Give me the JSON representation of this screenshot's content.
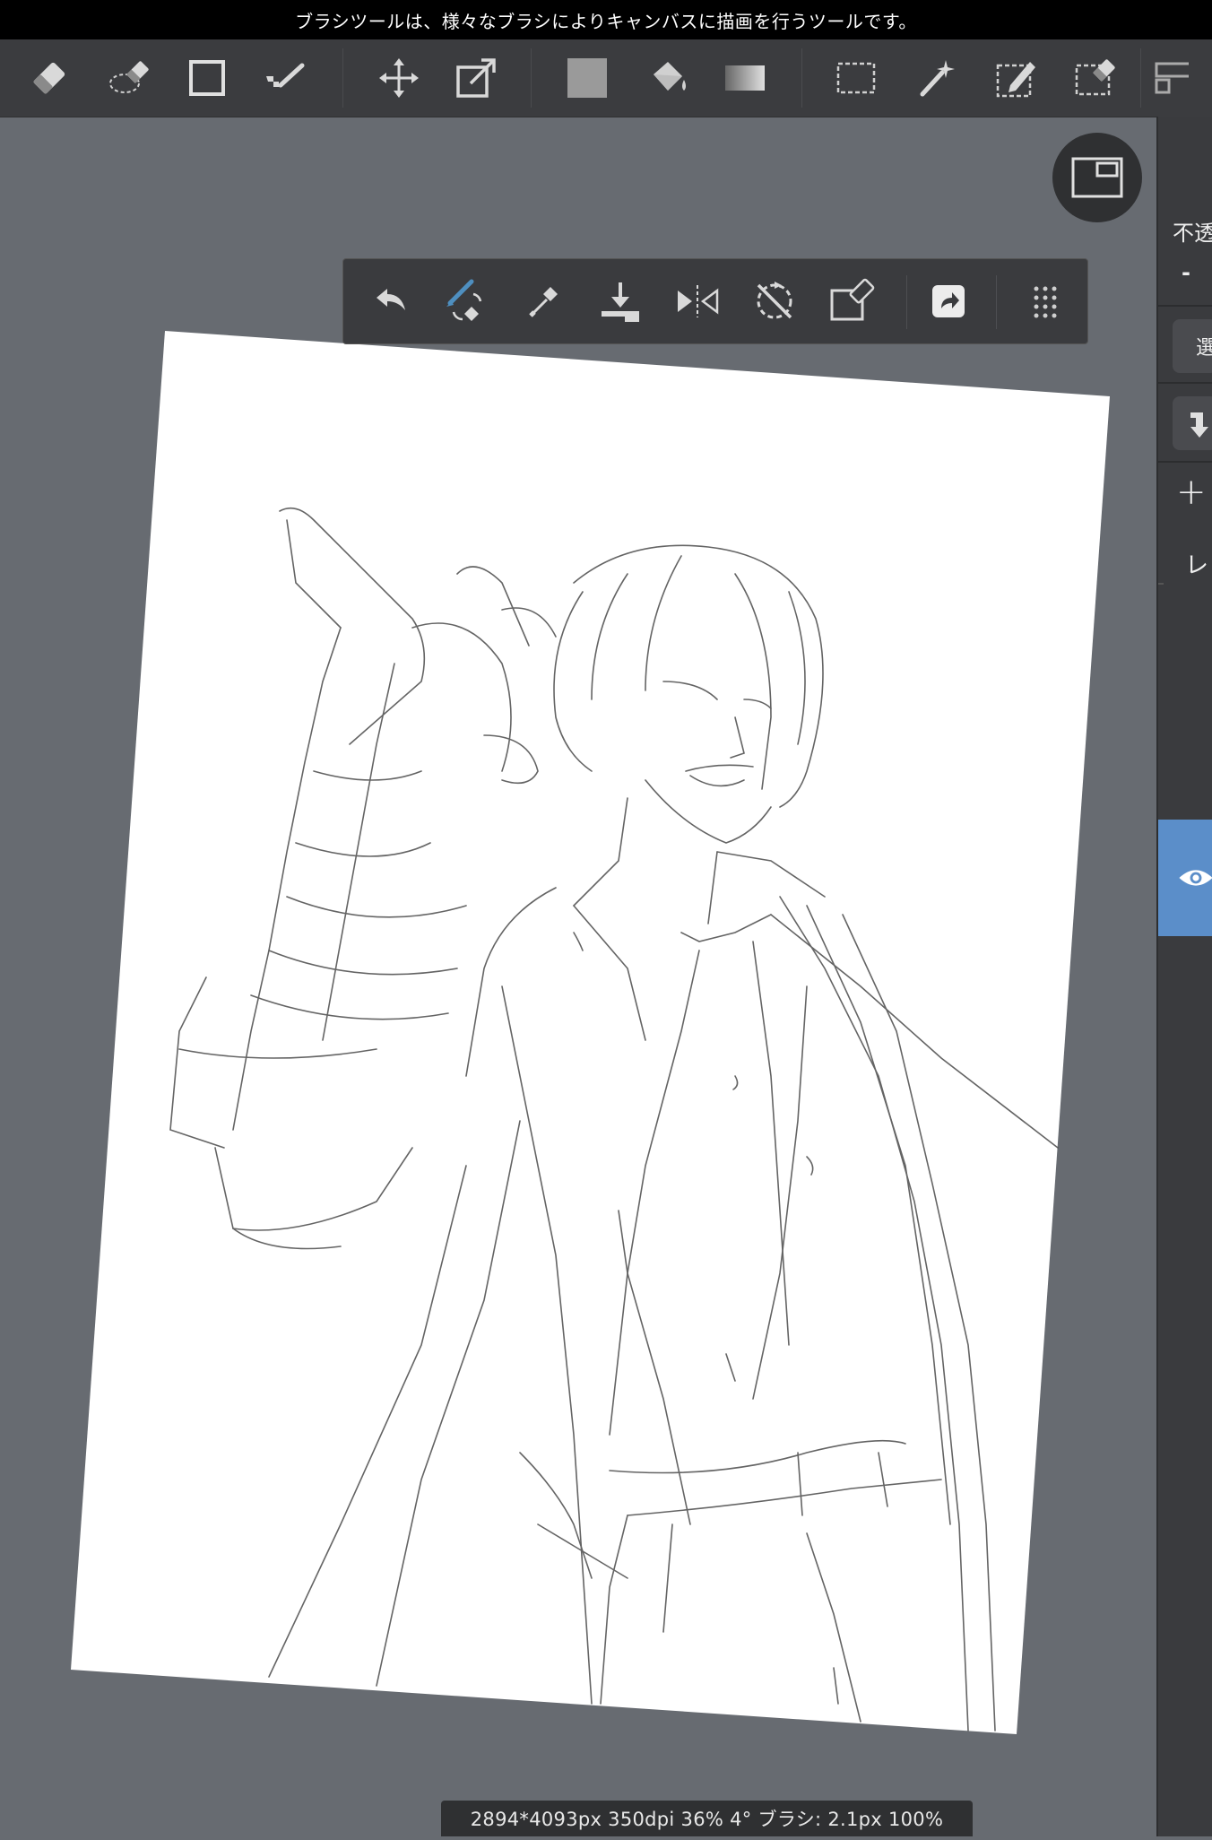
{
  "tooltip": {
    "text": "ブラシツールは、様々なブラシによりキャンバスに描画を行うツールです。"
  },
  "toolbar": {
    "tools": [
      {
        "name": "eraser-tool-icon"
      },
      {
        "name": "lasso-eraser-tool-icon"
      },
      {
        "name": "rectangle-tool-icon"
      },
      {
        "name": "lasso-fill-tool-icon"
      },
      {
        "name": "move-tool-icon"
      },
      {
        "name": "transform-tool-icon"
      },
      {
        "name": "color-fill-swatch-icon"
      },
      {
        "name": "bucket-fill-tool-icon"
      },
      {
        "name": "gradient-tool-icon"
      },
      {
        "name": "rectangle-selection-tool-icon"
      },
      {
        "name": "magic-wand-tool-icon"
      },
      {
        "name": "selection-pen-tool-icon"
      },
      {
        "name": "selection-eraser-tool-icon"
      },
      {
        "name": "layout-icon"
      }
    ]
  },
  "right_panel": {
    "opacity_label": "不透",
    "minus_label": "-",
    "select_label": "選",
    "plus_label": "+",
    "layer_label": "レ"
  },
  "sub_toolbar": {
    "items": [
      "undo-icon",
      "brush-color-swap-icon",
      "eyedropper-icon",
      "import-icon",
      "flip-horizontal-icon",
      "rotation-reset-icon",
      "clear-selection-icon",
      "share-icon",
      "more-grid-icon"
    ]
  },
  "colors": {
    "background": "#676b71",
    "toolbar": "#3b3c3f",
    "accent": "#5b8ec9",
    "active_brush": "#4e8fc0"
  },
  "status": {
    "text": "2894*4093px 350dpi 36% 4° ブラシ: 2.1px 100%"
  }
}
